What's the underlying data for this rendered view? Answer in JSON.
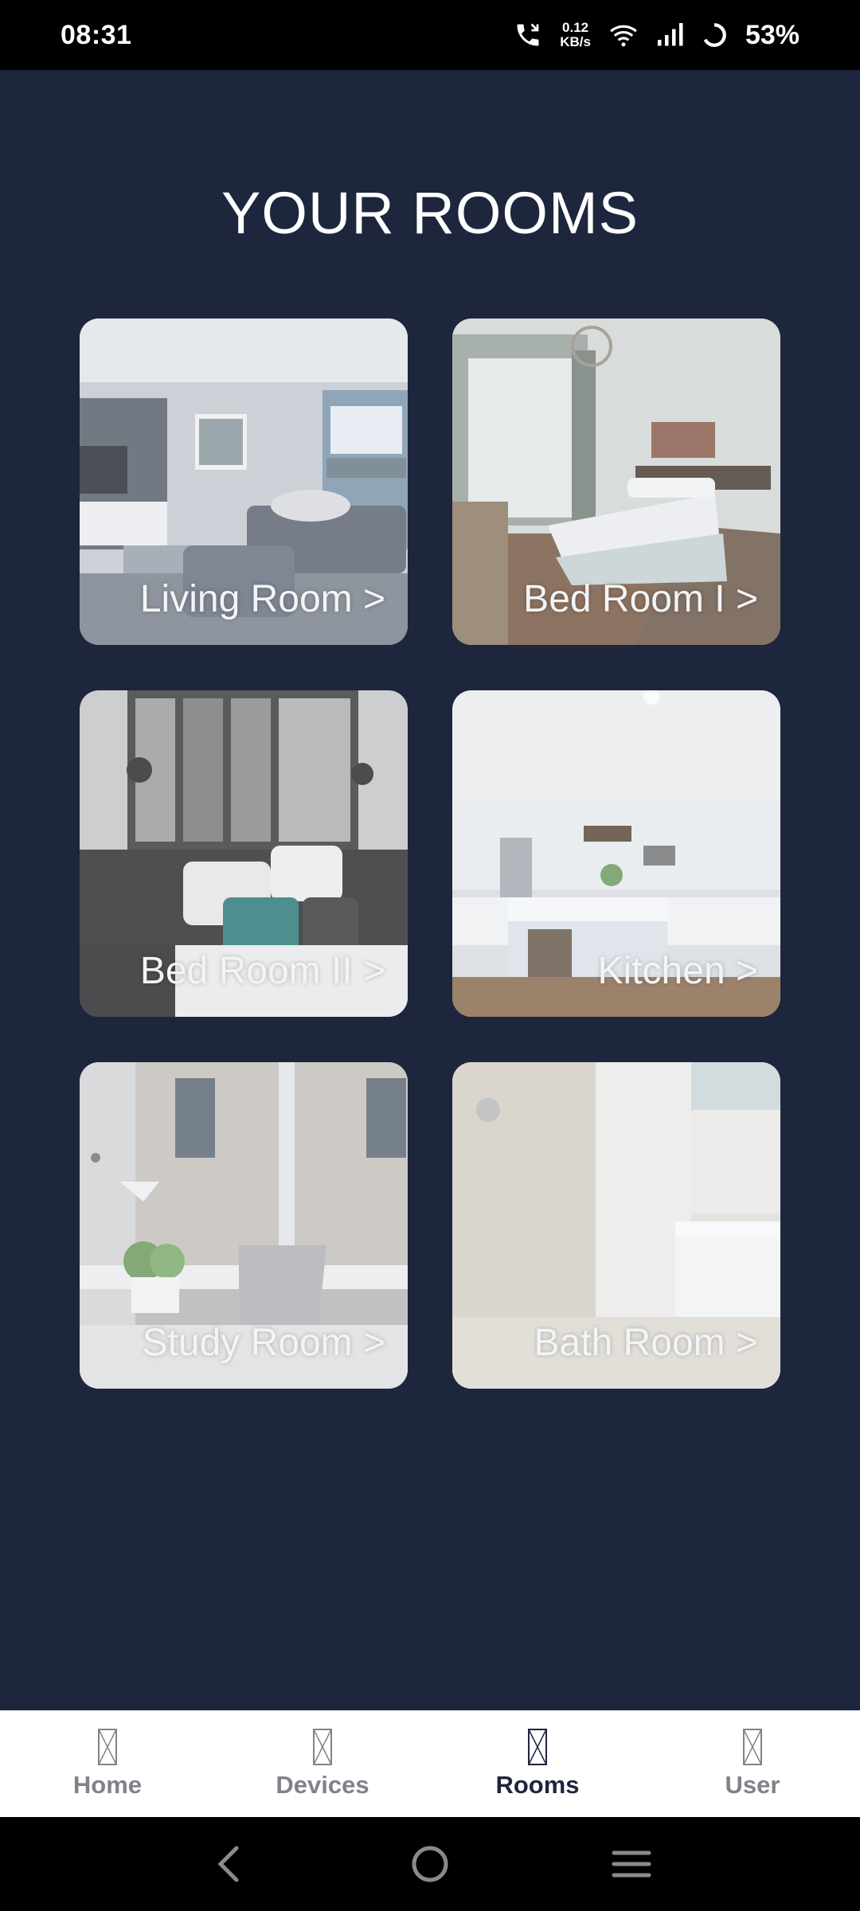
{
  "status_bar": {
    "time": "08:31",
    "net_speed_value": "0.12",
    "net_speed_unit": "KB/s",
    "battery": "53%"
  },
  "title": "YOUR ROOMS",
  "rooms": [
    {
      "label": "Living Room >"
    },
    {
      "label": "Bed Room I >"
    },
    {
      "label": "Bed Room II >"
    },
    {
      "label": "Kitchen >"
    },
    {
      "label": "Study Room >"
    },
    {
      "label": "Bath Room >"
    }
  ],
  "nav": {
    "items": [
      {
        "label": "Home"
      },
      {
        "label": "Devices"
      },
      {
        "label": "Rooms"
      },
      {
        "label": "User"
      }
    ],
    "active": "Rooms"
  },
  "colors": {
    "background": "#1d263c",
    "nav_active": "#1d263c",
    "nav_inactive": "#7f8389"
  }
}
